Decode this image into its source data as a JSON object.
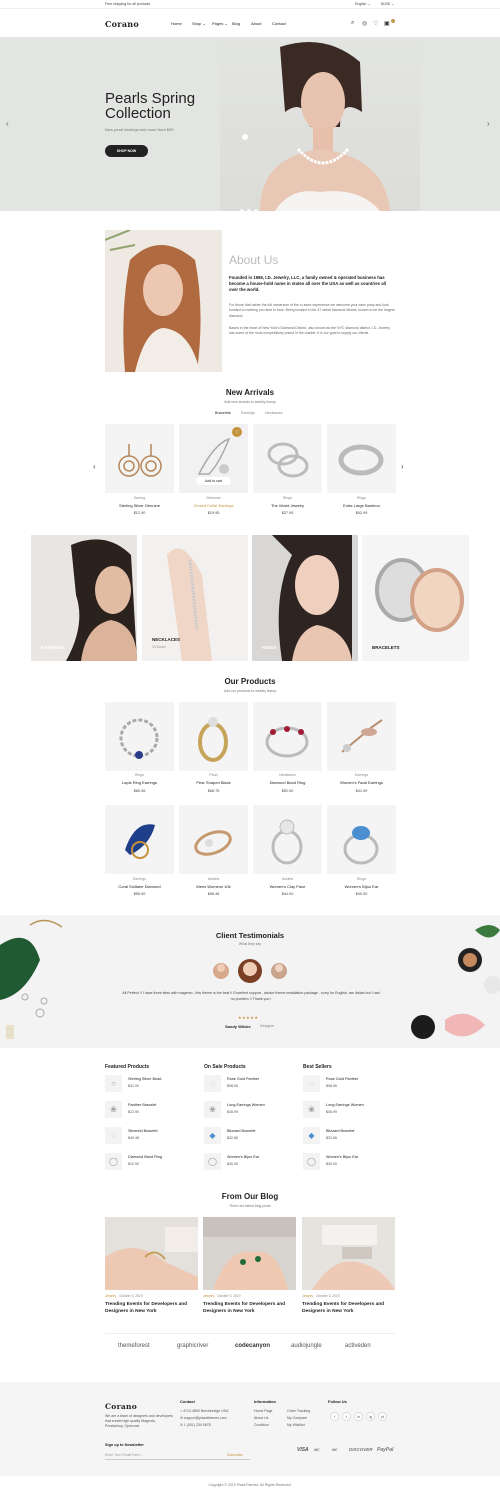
{
  "topbar": {
    "shipping": "Free shipping for all products",
    "language": "English ⌄",
    "currency": "$USD ⌄"
  },
  "header": {
    "logo": "Corano",
    "nav": [
      "Home",
      "Shop ⌄",
      "Pages ⌄",
      "Blog",
      "About",
      "Contact"
    ],
    "icons": [
      "search-icon",
      "user-icon",
      "heart-icon",
      "cart-icon"
    ]
  },
  "hero": {
    "title": "Pearls Spring Collection",
    "subtitle": "New pearl earrings and more from $99",
    "button": "SHOP NOW"
  },
  "about": {
    "heading": "About Us",
    "lead": "Founded in 1986, I.D. Jewelry, LLC, a family owned & operated business has become a house-hold name in states all over the USA as well as countries all over the world.",
    "p1": "For those that rather the full immersion of the in-store experience we welcome your cami pany and look forward to meeting you face to face. Being located in the 47 street diamond district, known to be the largest diamond.",
    "p2": "Based in the heart of New York's Diamond District, also known as the NYC diamond district, I.D. Jewelry has some of the most competitively priced in the market. It is our goal to supply our clients."
  },
  "new_arrivals": {
    "title": "New Arrivals",
    "subtitle": "Add new arrivals to weekly lineup",
    "tabs": [
      "Bracelets",
      "Earrings",
      "Necklaces"
    ],
    "add_to_cart": "Add to cart",
    "items": [
      {
        "cat": "Earring",
        "name": "Sterling Silver Genuine",
        "price": "$12.90"
      },
      {
        "cat": "Diamond",
        "name": "Closed Collar Earrings",
        "price": "$19.95"
      },
      {
        "cat": "Rings",
        "name": "The World Jewelry",
        "price": "$27.99"
      },
      {
        "cat": "Rings",
        "name": "Extra Large Bamboo",
        "price": "$42.99"
      }
    ]
  },
  "categories": [
    {
      "label": "EARRINGS",
      "count": ""
    },
    {
      "label": "NECKLACES",
      "count": "33 Model"
    },
    {
      "label": "RINGS",
      "count": ""
    },
    {
      "label": "BRACELETS",
      "count": ""
    }
  ],
  "products": {
    "title": "Our Products",
    "subtitle": "Add our products to weekly lineup",
    "items": [
      {
        "cat": "Rings",
        "name": "Lapis Ring Earrings",
        "price": "$80.06"
      },
      {
        "cat": "Pearl",
        "name": "Pear Shaped Black",
        "price": "$68.75"
      },
      {
        "cat": "Necklaces",
        "name": "Diamond Band Ring",
        "price": "$52.90"
      },
      {
        "cat": "Earrings",
        "name": "Women's Fada Earrings",
        "price": "$41.99"
      },
      {
        "cat": "Earrings",
        "name": "Coral Solitaire Diamond",
        "price": "$55.90"
      },
      {
        "cat": "Anklets",
        "name": "Mens Womens 10k",
        "price": "$98.46"
      },
      {
        "cat": "Anklets",
        "name": "Women's Clay Pave",
        "price": "$44.00"
      },
      {
        "cat": "Rings",
        "name": "Women's Bijou Ear",
        "price": "$40.00"
      }
    ]
  },
  "testimonials": {
    "title": "Client Testimonials",
    "subtitle": "What they say",
    "quote": "All Perfect !! I have three sites with magento , this theme is the best !! Excellent support , advice theme installation package , sorry for English, are Italian but I had no problem !! Thank you !",
    "stars": "★★★★★",
    "author": "Sandy Wilcke",
    "role": "Designer"
  },
  "lists": [
    {
      "title": "Featured Products",
      "items": [
        {
          "name": "Sterling Silver Bead",
          "price": "$31.00"
        },
        {
          "name": "Panther Bracelet",
          "price": "$12.90"
        },
        {
          "name": "Silvereid Bracelet",
          "price": "$49.48"
        },
        {
          "name": "Diamond Band Ring",
          "price": "$12.90"
        }
      ]
    },
    {
      "title": "On Sale Products",
      "items": [
        {
          "name": "Rose Gold Panther",
          "price": "$98.06"
        },
        {
          "name": "Long Earrings Women",
          "price": "$45.99"
        },
        {
          "name": "Blizzard Bracelet",
          "price": "$32.86"
        },
        {
          "name": "Women's Bijou Ear",
          "price": "$40.00"
        }
      ]
    },
    {
      "title": "Best Sellers",
      "items": [
        {
          "name": "Rose Gold Panther",
          "price": "$98.06"
        },
        {
          "name": "Long Earrings Women",
          "price": "$45.99"
        },
        {
          "name": "Blizzard Bracelet",
          "price": "$32.86"
        },
        {
          "name": "Women's Bijou Ear",
          "price": "$40.00"
        }
      ]
    }
  ],
  "blog": {
    "title": "From Our Blog",
    "subtitle": "There are latest blog posts",
    "posts": [
      {
        "tag": "Jewelry",
        "date": "October 3, 2019",
        "title": "Trending Events for Developers and Designers in New York"
      },
      {
        "tag": "Jewelry",
        "date": "October 3, 2019",
        "title": "Trending Events for Developers and Designers in New York"
      },
      {
        "tag": "Jewelry",
        "date": "October 3, 2019",
        "title": "Trending Events for Developers and Designers in New York"
      }
    ]
  },
  "brands": [
    "themeforest",
    "graphicriver",
    "codecanyon",
    "audiojungle",
    "activeden"
  ],
  "footer": {
    "logo": "Corano",
    "about": "We are a team of designers and developers that create high quality Magento, Prestashop, Opencart.",
    "newsletter_title": "Sign up to Newsletter",
    "newsletter_placeholder": "Enter Your Email Here...",
    "subscribe": "Subscribe",
    "contact_title": "Contact",
    "contact": [
      "4710-4890 Breckinridge USA",
      "support@plazathemes.com",
      "1 (001) 234 5678"
    ],
    "info_title": "Information",
    "info_col1": [
      "Home Page",
      "About Us",
      "Condition"
    ],
    "info_col2": [
      "Order Tracking",
      "My Compare",
      "My Wishlist"
    ],
    "follow_title": "Follow Us",
    "social": [
      "f",
      "t",
      "in",
      "ig",
      "yt"
    ],
    "payments": [
      "VISA",
      "MC",
      "MC",
      "DISCOVER",
      "PayPal"
    ],
    "copyright": "Copyright © 2019 PlazaThemes. All Rights Reserved."
  }
}
